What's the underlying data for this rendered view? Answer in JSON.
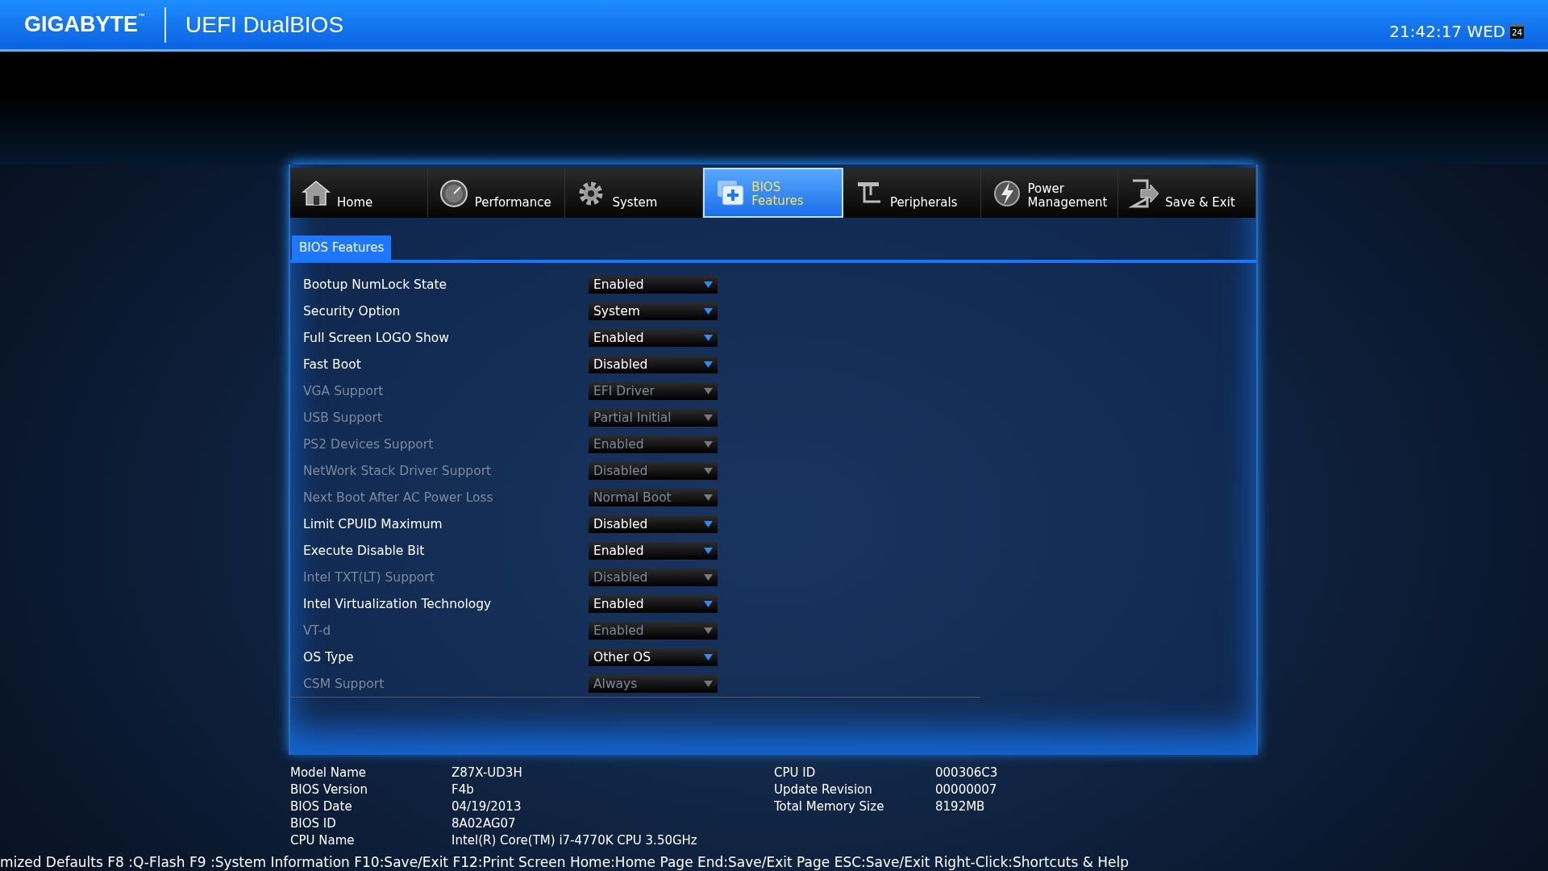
{
  "header": {
    "brand": "GIGABYTE",
    "trademark": "™",
    "title": "UEFI DualBIOS",
    "clock": "21:42:17 WED",
    "calendar_day": "24"
  },
  "tabs": [
    {
      "label": "Home",
      "kind": "home",
      "selected": false
    },
    {
      "label": "Performance",
      "kind": "gauge",
      "selected": false
    },
    {
      "label": "System",
      "kind": "gear",
      "selected": false
    },
    {
      "label": "BIOS\nFeatures",
      "kind": "chip",
      "selected": true
    },
    {
      "label": "Peripherals",
      "kind": "plug",
      "selected": false
    },
    {
      "label": "Power\nManagement",
      "kind": "power",
      "selected": false
    },
    {
      "label": "Save & Exit",
      "kind": "exit",
      "selected": false
    }
  ],
  "section_tab": {
    "label": "BIOS Features",
    "selected": true
  },
  "settings": [
    {
      "name": "Bootup NumLock State",
      "value": "Enabled",
      "disabled": false
    },
    {
      "name": "Security Option",
      "value": "System",
      "disabled": false
    },
    {
      "name": "Full Screen LOGO Show",
      "value": "Enabled",
      "disabled": false
    },
    {
      "name": "Fast Boot",
      "value": "Disabled",
      "disabled": false
    },
    {
      "name": "VGA Support",
      "value": "EFI Driver",
      "disabled": true
    },
    {
      "name": "USB Support",
      "value": "Partial Initial",
      "disabled": true
    },
    {
      "name": "PS2 Devices Support",
      "value": "Enabled",
      "disabled": true
    },
    {
      "name": "NetWork Stack Driver Support",
      "value": "Disabled",
      "disabled": true
    },
    {
      "name": "Next Boot After AC Power Loss",
      "value": "Normal Boot",
      "disabled": true
    },
    {
      "name": "Limit CPUID Maximum",
      "value": "Disabled",
      "disabled": false
    },
    {
      "name": "Execute Disable Bit",
      "value": "Enabled",
      "disabled": false
    },
    {
      "name": "Intel TXT(LT) Support",
      "value": "Disabled",
      "disabled": true
    },
    {
      "name": "Intel Virtualization Technology",
      "value": "Enabled",
      "disabled": false
    },
    {
      "name": "VT-d",
      "value": "Enabled",
      "disabled": true
    },
    {
      "name": "OS Type",
      "value": "Other OS",
      "disabled": false
    },
    {
      "name": "CSM Support",
      "value": "Always",
      "disabled": true
    }
  ],
  "system_info": {
    "left": [
      {
        "label": "Model Name",
        "value": "Z87X-UD3H"
      },
      {
        "label": "BIOS Version",
        "value": "F4b"
      },
      {
        "label": "BIOS Date",
        "value": "04/19/2013"
      },
      {
        "label": "BIOS ID",
        "value": "8A02AG07"
      },
      {
        "label": "CPU Name",
        "value": "Intel(R) Core(TM) i7-4770K CPU  3.50GHz"
      }
    ],
    "right": [
      {
        "label": "CPU ID",
        "value": "000306C3"
      },
      {
        "label": "Update Revision",
        "value": "00000007"
      },
      {
        "label": "Total Memory Size",
        "value": "8192MB"
      }
    ]
  },
  "status_bar": "mized Defaults F8 :Q-Flash F9 :System Information F10:Save/Exit F12:Print Screen Home:Home Page End:Save/Exit Page ESC:Save/Exit Right-Click:Shortcuts & Help"
}
